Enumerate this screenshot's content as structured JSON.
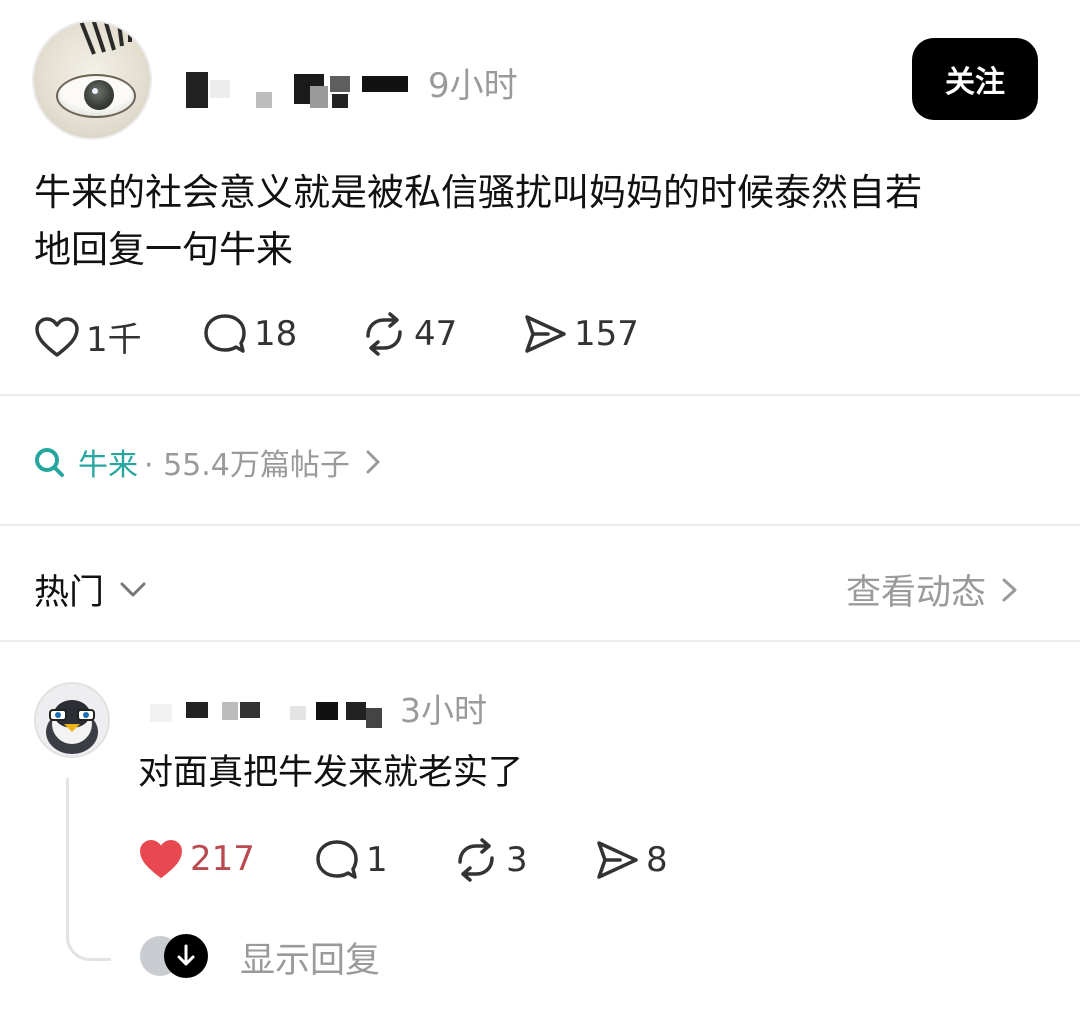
{
  "post": {
    "time": "9小时",
    "follow_label": "关注",
    "text_lines": [
      "牛来的社会意义就是被私信骚扰叫妈妈的时候泰然自若",
      "地回复一句牛来"
    ],
    "actions": {
      "likes": "1千",
      "comments": "18",
      "reposts": "47",
      "shares": "157"
    }
  },
  "topic": {
    "name": "牛来",
    "meta": "· 55.4万篇帖子"
  },
  "sort": {
    "label": "热门",
    "view_activity": "查看动态"
  },
  "comment": {
    "time": "3小时",
    "text": "对面真把牛发来就老实了",
    "actions": {
      "likes": "217",
      "comments": "1",
      "reposts": "3",
      "shares": "8"
    },
    "liked": true,
    "show_replies": "显示回复"
  },
  "colors": {
    "like_active": "#e8484f",
    "topic_accent": "#27a6a0",
    "muted": "#9a9a9a"
  },
  "icons": [
    "heart-icon",
    "comment-icon",
    "repost-icon",
    "share-icon",
    "search-icon",
    "chevron-right-icon",
    "chevron-down-icon",
    "arrow-down-icon"
  ]
}
